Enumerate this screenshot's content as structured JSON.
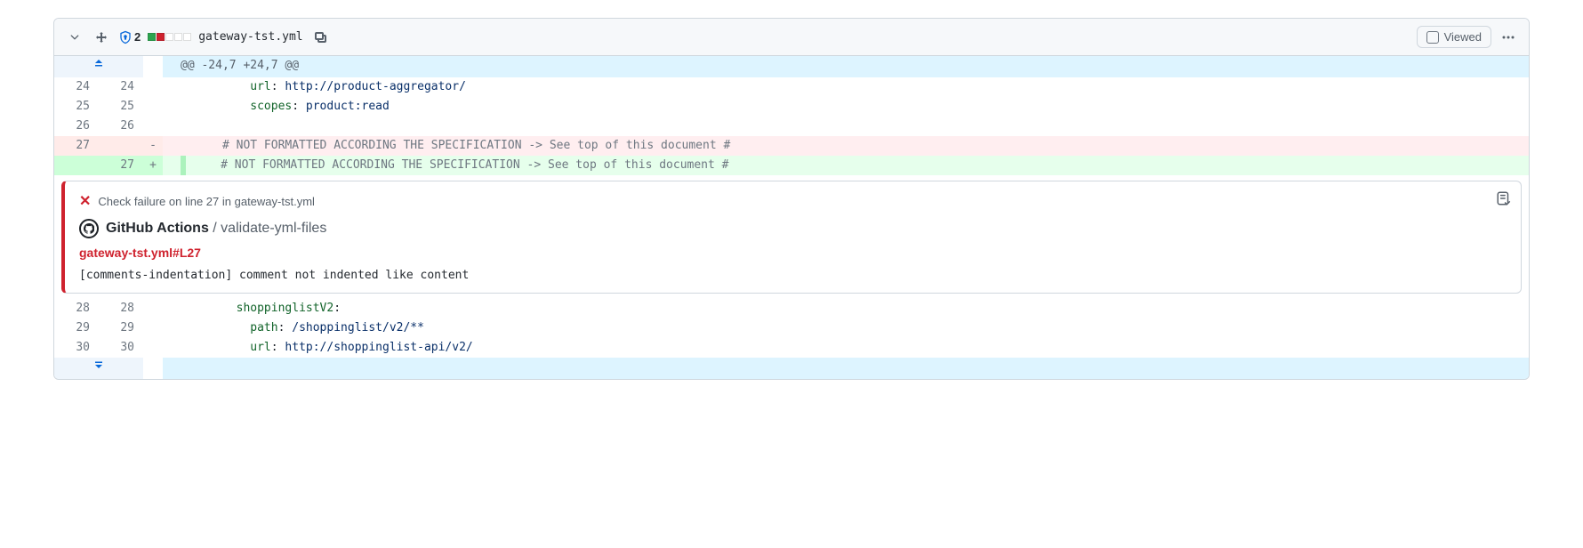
{
  "header": {
    "security_count": "2",
    "filename": "gateway-tst.yml",
    "viewed_label": "Viewed"
  },
  "hunk": {
    "header": "@@ -24,7 +24,7 @@"
  },
  "lines": {
    "l24": {
      "old": "24",
      "new": "24",
      "key1": "url",
      "val1": "http://product-aggregator/"
    },
    "l25": {
      "old": "25",
      "new": "25",
      "key1": "scopes",
      "val1": "product:read"
    },
    "l26": {
      "old": "26",
      "new": "26"
    },
    "del27": {
      "old": "27",
      "op": "-",
      "comment": "# NOT FORMATTED ACCORDING THE SPECIFICATION -> See top of this document #"
    },
    "add27": {
      "new": "27",
      "op": "+",
      "comment": "# NOT FORMATTED ACCORDING THE SPECIFICATION -> See top of this document #"
    },
    "l28": {
      "old": "28",
      "new": "28",
      "key1": "shoppinglistV2"
    },
    "l29": {
      "old": "29",
      "new": "29",
      "key1": "path",
      "val1": "/shoppinglist/v2/**"
    },
    "l30": {
      "old": "30",
      "new": "30",
      "key1": "url",
      "val1": "http://shoppinglist-api/v2/"
    }
  },
  "annotation": {
    "head": "Check failure on line 27 in gateway-tst.yml",
    "source_strong": "GitHub Actions",
    "source_suffix": " / validate-yml-files",
    "link": "gateway-tst.yml#L27",
    "message": "[comments-indentation] comment not indented like content"
  }
}
